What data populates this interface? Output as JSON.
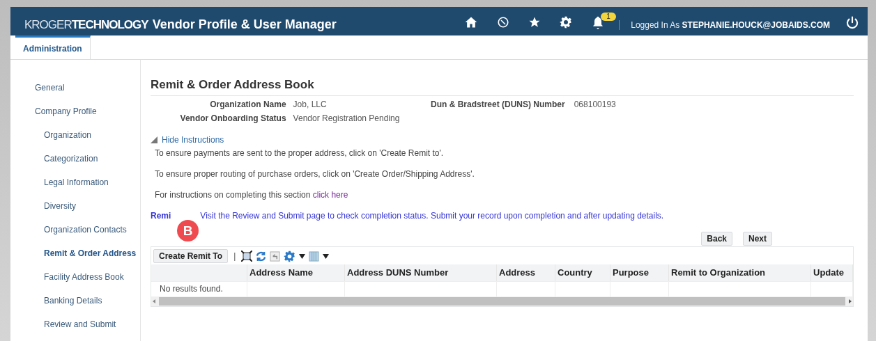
{
  "header": {
    "brand_light": "KROGER",
    "brand_bold": "TECHNOLOGY",
    "title": "Vendor Profile & User Manager",
    "notification_count": "1",
    "logged_in_label": "Logged In As",
    "user": "STEPHANIE.HOUCK@JOBAIDS.COM"
  },
  "tabs": [
    {
      "label": "Administration",
      "selected": true
    }
  ],
  "sidebar": {
    "items": [
      {
        "label": "General",
        "selected": false
      },
      {
        "label": "Company Profile",
        "selected": false,
        "children": [
          {
            "label": "Organization",
            "selected": false
          },
          {
            "label": "Categorization",
            "selected": false
          },
          {
            "label": "Legal Information",
            "selected": false
          },
          {
            "label": "Diversity",
            "selected": false
          },
          {
            "label": "Organization Contacts",
            "selected": false
          },
          {
            "label": "Remit & Order Address",
            "selected": true
          },
          {
            "label": "Facility Address Book",
            "selected": false
          },
          {
            "label": "Banking Details",
            "selected": false
          },
          {
            "label": "Review and Submit",
            "selected": false
          }
        ]
      }
    ]
  },
  "page": {
    "title": "Remit & Order Address Book",
    "fields": [
      {
        "label": "Organization Name",
        "value": "Job, LLC"
      },
      {
        "label": "Vendor Onboarding Status",
        "value": "Vendor Registration Pending"
      }
    ],
    "duns": {
      "label": "Dun & Bradstreet (DUNS) Number",
      "value": "068100193"
    },
    "instructions": {
      "toggle": "Hide Instructions",
      "expanded": true,
      "lines": [
        "To ensure payments are sent to the proper address, click on 'Create Remit to'.",
        "To ensure proper routing of purchase orders, click on 'Create Order/Shipping Address'."
      ],
      "link_prefix": "For instructions on completing this section",
      "link": "click here"
    },
    "reminder": {
      "label": "Remi",
      "text": "Visit the Review and Submit page to check completion status. Submit your record upon completion and after updating details."
    },
    "callout": "B",
    "buttons": [
      "Back",
      "Next"
    ],
    "table": {
      "create_button": "Create Remit To",
      "separator": "|",
      "columns": [
        "Address Name",
        "Address DUNS Number",
        "Address",
        "Country",
        "Purpose",
        "Remit to Organization",
        "Update"
      ],
      "empty_message": "No results found."
    }
  }
}
